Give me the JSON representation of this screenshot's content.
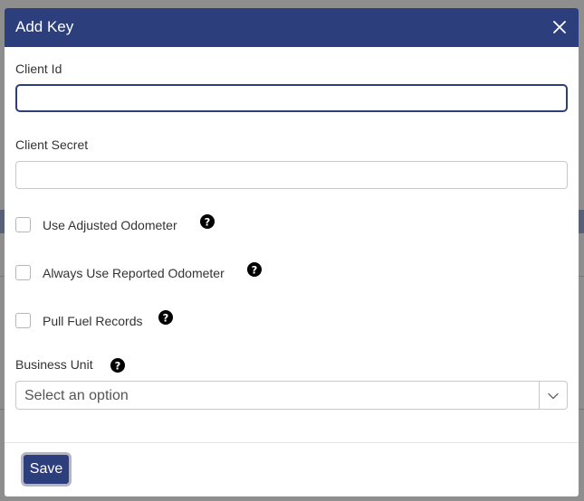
{
  "dialog": {
    "title": "Add Key",
    "close_icon": "close-icon"
  },
  "fields": {
    "client_id": {
      "label": "Client Id",
      "value": "",
      "placeholder": ""
    },
    "client_secret": {
      "label": "Client Secret",
      "value": "",
      "placeholder": ""
    }
  },
  "checkboxes": [
    {
      "label": "Use Adjusted Odometer",
      "checked": false,
      "help_icon": "question-circle-icon"
    },
    {
      "label": "Always Use Reported Odometer",
      "checked": false,
      "help_icon": "question-circle-icon"
    },
    {
      "label": "Pull Fuel Records",
      "checked": false,
      "help_icon": "question-circle-icon"
    }
  ],
  "business_unit": {
    "label": "Business Unit",
    "help_icon": "question-circle-icon",
    "placeholder": "Select an option",
    "dropdown_icon": "chevron-down-icon"
  },
  "footer": {
    "save_label": "Save"
  },
  "colors": {
    "header_background": "#2d3e7c",
    "primary_button": "#2d3e7c",
    "focus_border": "#2d3e7c"
  }
}
